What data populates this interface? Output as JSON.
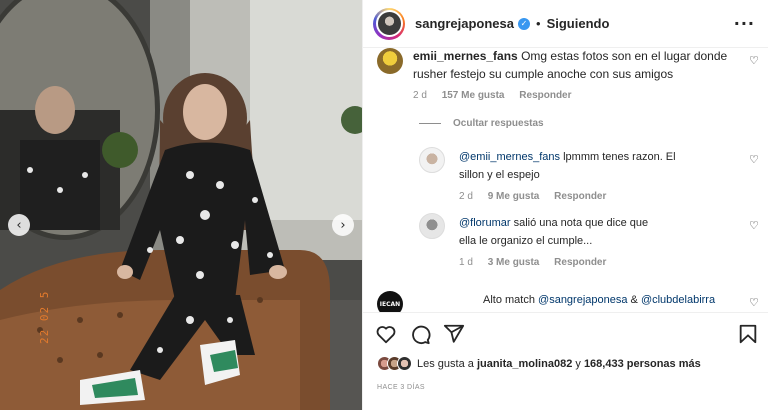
{
  "post": {
    "photo": {
      "description_icon": "photo-icon",
      "date_stamp": "22 02 5"
    },
    "nav": {
      "prev_icon": "chevron-left-icon",
      "prev_glyph": "‹",
      "next_icon": "chevron-right-icon",
      "next_glyph": "›"
    }
  },
  "header": {
    "username": "sangrejaponesa",
    "verified_glyph": "✓",
    "separator": "•",
    "follow_state": "Siguiendo",
    "more_glyph": "···"
  },
  "comments": [
    {
      "user": "emii_mernes_fans",
      "text": "Omg estas fotos son en el lugar donde",
      "text2": "rusher festejo su cumple anoche con sus amigos",
      "time": "2 d",
      "likes": "157 Me gusta",
      "reply": "Responder",
      "hide_replies": "Ocultar respuestas"
    },
    {
      "mention": "@emii_mernes_fans",
      "text": " lpmmm tenes razon. El",
      "text2": "sillon y el espejo",
      "time": "2 d",
      "likes": "9 Me gusta",
      "reply": "Responder"
    },
    {
      "mention": "@florumar",
      "text": " salió una nota que dice que",
      "text2": "ella le organizo el cumple...",
      "time": "1 d",
      "likes": "3 Me gusta",
      "reply": "Responder"
    },
    {
      "avatar_text": "IECAN",
      "text": "Alto match ",
      "mention": "@sangrejaponesa",
      "amp": " & ",
      "mention2": "@clubdelabirra"
    }
  ],
  "likes": {
    "prefix": "Les gusta a ",
    "user": "juanita_molina082",
    "middle": " y ",
    "count": "168,433 personas más"
  },
  "date": "Hace 3 días",
  "colors": {
    "accent": "#3897f0",
    "mention": "#00376b",
    "muted": "#8e8e8e",
    "stamp": "#e37a2c"
  }
}
